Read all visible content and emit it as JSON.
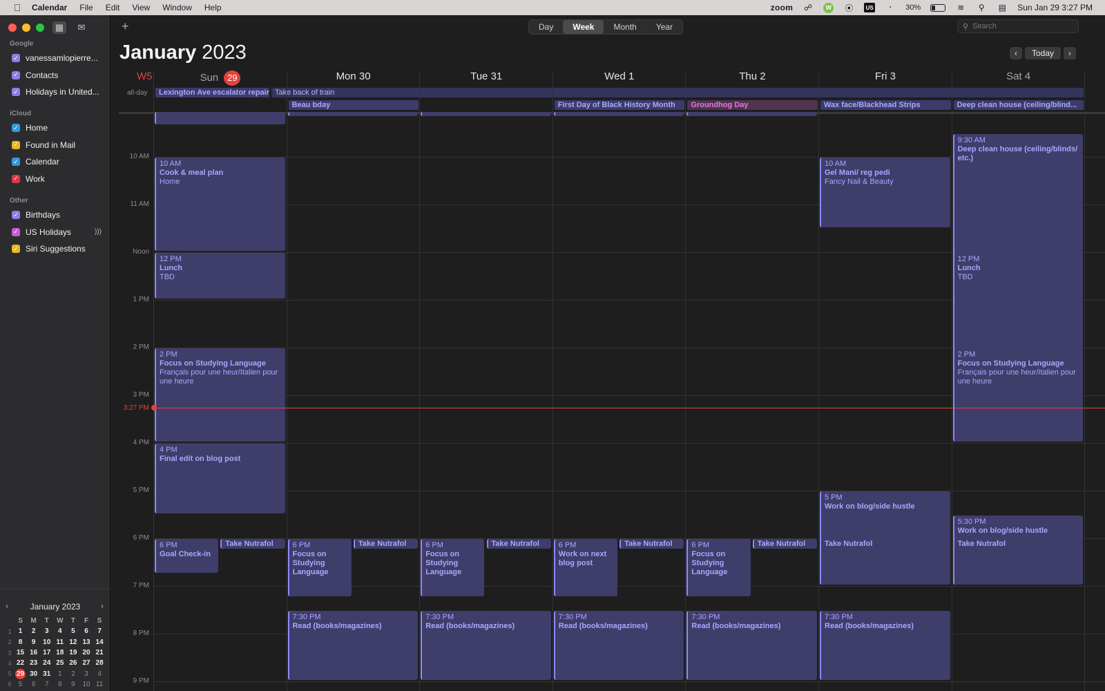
{
  "menubar": {
    "app_name": "Calendar",
    "items": [
      "File",
      "Edit",
      "View",
      "Window",
      "Help"
    ],
    "zoom": "zoom",
    "w_badge": "W",
    "us_badge": "US",
    "battery_pct": "30%",
    "battery_level": 0.3,
    "datetime": "Sun Jan 29  3:27 PM"
  },
  "sidebar": {
    "google_heading": "Google",
    "google": [
      {
        "label": "vanessamlopierre...",
        "color": "#8e7fe6"
      },
      {
        "label": "Contacts",
        "color": "#8e7fe6"
      },
      {
        "label": "Holidays in United...",
        "color": "#8e7fe6"
      }
    ],
    "icloud_heading": "iCloud",
    "icloud": [
      {
        "label": "Home",
        "color": "#2f9ce0"
      },
      {
        "label": "Found in Mail",
        "color": "#e9b823"
      },
      {
        "label": "Calendar",
        "color": "#2f9ce0"
      },
      {
        "label": "Work",
        "color": "#e0344a"
      }
    ],
    "other_heading": "Other",
    "other": [
      {
        "label": "Birthdays",
        "color": "#8e7fe6"
      },
      {
        "label": "US Holidays",
        "color": "#c65cd8"
      },
      {
        "label": "Siri Suggestions",
        "color": "#e9b823"
      }
    ]
  },
  "mini_calendar": {
    "title": "January 2023",
    "headers": [
      "S",
      "M",
      "T",
      "W",
      "T",
      "F",
      "S"
    ],
    "weeks": [
      {
        "wk": "1",
        "days": [
          "1",
          "2",
          "3",
          "4",
          "5",
          "6",
          "7"
        ]
      },
      {
        "wk": "2",
        "days": [
          "8",
          "9",
          "10",
          "11",
          "12",
          "13",
          "14"
        ]
      },
      {
        "wk": "3",
        "days": [
          "15",
          "16",
          "17",
          "18",
          "19",
          "20",
          "21"
        ]
      },
      {
        "wk": "4",
        "days": [
          "22",
          "23",
          "24",
          "25",
          "26",
          "27",
          "28"
        ]
      },
      {
        "wk": "5",
        "days": [
          "29",
          "30",
          "31",
          "1",
          "2",
          "3",
          "4"
        ]
      },
      {
        "wk": "6",
        "days": [
          "5",
          "6",
          "7",
          "8",
          "9",
          "10",
          "11"
        ]
      }
    ],
    "today": "29"
  },
  "toolbar": {
    "add": "+",
    "views": [
      "Day",
      "Week",
      "Month",
      "Year"
    ],
    "active_view": "Week",
    "search_placeholder": "Search",
    "today": "Today"
  },
  "header": {
    "month": "January",
    "year": "2023",
    "week": "W5",
    "days": [
      {
        "name": "Sun",
        "num": "29",
        "today": true
      },
      {
        "name": "Mon",
        "num": "30"
      },
      {
        "name": "Tue",
        "num": "31"
      },
      {
        "name": "Wed",
        "num": "1"
      },
      {
        "name": "Thu",
        "num": "2"
      },
      {
        "name": "Fri",
        "num": "3"
      },
      {
        "name": "Sat",
        "num": "4"
      }
    ]
  },
  "allday_label": "all-day",
  "allday_events": [
    {
      "title": "Lexington Ave escalator repair",
      "day": 0,
      "span": 1,
      "row": 0,
      "style": "blue"
    },
    {
      "title": "Take back of train",
      "day": 0,
      "span": 7,
      "row": 0,
      "style": "plain"
    },
    {
      "title": "Beau bday",
      "day": 1,
      "span": 1,
      "row": 1,
      "style": "blue"
    },
    {
      "title": "First Day of Black History Month",
      "day": 3,
      "span": 1,
      "row": 1,
      "style": "blue"
    },
    {
      "title": "Groundhog Day",
      "day": 4,
      "span": 1,
      "row": 1,
      "style": "pink"
    },
    {
      "title": "Wax face/Blackhead Strips",
      "day": 5,
      "span": 1,
      "row": 1,
      "style": "blue"
    },
    {
      "title": "Deep clean house (ceiling/blind...",
      "day": 6,
      "span": 1,
      "row": 1,
      "style": "blue"
    }
  ],
  "hours": [
    "10 AM",
    "11 AM",
    "Noon",
    "1 PM",
    "2 PM",
    "3 PM",
    "4 PM",
    "5 PM",
    "6 PM",
    "7 PM",
    "8 PM",
    "9 PM"
  ],
  "now_label": "3:27 PM",
  "events": [
    {
      "day": 0,
      "start": 10,
      "end": 12,
      "time": "10 AM",
      "title": "Cook & meal plan",
      "loc": "Home"
    },
    {
      "day": 0,
      "start": 12,
      "end": 13,
      "time": "12 PM",
      "title": "Lunch",
      "loc": "TBD"
    },
    {
      "day": 0,
      "start": 14,
      "end": 16,
      "time": "2 PM",
      "title": "Focus on Studying Language",
      "loc": "Français pour une heur/Italien pour une heure"
    },
    {
      "day": 0,
      "start": 16,
      "end": 17.5,
      "time": "4 PM",
      "title": "Final edit on blog post",
      "loc": ""
    },
    {
      "day": 0,
      "start": 18,
      "end": 18.75,
      "time": "6 PM",
      "title": "Goal Check-in",
      "loc": "",
      "half": "left"
    },
    {
      "day": 0,
      "start": 18,
      "end": 18.25,
      "time": "",
      "title": "Take Nutrafol",
      "loc": "",
      "half": "right"
    },
    {
      "day": 1,
      "start": 18,
      "end": 19.25,
      "time": "6 PM",
      "title": "Focus on Studying Language",
      "loc": "",
      "half": "left"
    },
    {
      "day": 1,
      "start": 18,
      "end": 18.25,
      "time": "",
      "title": "Take Nutrafol",
      "loc": "",
      "half": "right"
    },
    {
      "day": 1,
      "start": 19.5,
      "end": 21,
      "time": "7:30 PM",
      "title": "Read (books/magazines)",
      "loc": ""
    },
    {
      "day": 2,
      "start": 18,
      "end": 19.25,
      "time": "6 PM",
      "title": "Focus on Studying Language",
      "loc": "",
      "half": "left"
    },
    {
      "day": 2,
      "start": 18,
      "end": 18.25,
      "time": "",
      "title": "Take Nutrafol",
      "loc": "",
      "half": "right"
    },
    {
      "day": 2,
      "start": 19.5,
      "end": 21,
      "time": "7:30 PM",
      "title": "Read (books/magazines)",
      "loc": ""
    },
    {
      "day": 3,
      "start": 18,
      "end": 19.25,
      "time": "6 PM",
      "title": "Work on next blog post",
      "loc": "",
      "half": "left"
    },
    {
      "day": 3,
      "start": 18,
      "end": 18.25,
      "time": "",
      "title": "Take Nutrafol",
      "loc": "",
      "half": "right"
    },
    {
      "day": 3,
      "start": 19.5,
      "end": 21,
      "time": "7:30 PM",
      "title": "Read (books/magazines)",
      "loc": ""
    },
    {
      "day": 4,
      "start": 18,
      "end": 19.25,
      "time": "6 PM",
      "title": "Focus on Studying Language",
      "loc": "",
      "half": "left"
    },
    {
      "day": 4,
      "start": 18,
      "end": 18.25,
      "time": "",
      "title": "Take Nutrafol",
      "loc": "",
      "half": "right"
    },
    {
      "day": 4,
      "start": 19.5,
      "end": 21,
      "time": "7:30 PM",
      "title": "Read (books/magazines)",
      "loc": ""
    },
    {
      "day": 5,
      "start": 10,
      "end": 11.5,
      "time": "10 AM",
      "title": "Gel Mani/ reg pedi",
      "loc": "Fancy Nail & Beauty"
    },
    {
      "day": 5,
      "start": 17,
      "end": 19,
      "time": "5 PM",
      "title": "Work on blog/side hustle",
      "loc": ""
    },
    {
      "day": 5,
      "start": 18,
      "end": 19,
      "time": "",
      "title": "Take Nutrafol",
      "loc": ""
    },
    {
      "day": 5,
      "start": 19.5,
      "end": 21,
      "time": "7:30 PM",
      "title": "Read (books/magazines)",
      "loc": ""
    },
    {
      "day": 6,
      "start": 9.5,
      "end": 16,
      "time": "9:30 AM",
      "title": "Deep clean house (ceiling/blinds/ etc.)",
      "loc": ""
    },
    {
      "day": 6,
      "start": 12,
      "end": 13,
      "time": "12 PM",
      "title": "Lunch",
      "loc": "TBD"
    },
    {
      "day": 6,
      "start": 14,
      "end": 16,
      "time": "2 PM",
      "title": "Focus on Studying Language",
      "loc": "Français pour une heur/Italien pour une heure"
    },
    {
      "day": 6,
      "start": 17.5,
      "end": 19,
      "time": "5:30 PM",
      "title": "Work on blog/side hustle",
      "loc": ""
    },
    {
      "day": 6,
      "start": 18,
      "end": 19,
      "time": "",
      "title": "Take Nutrafol",
      "loc": ""
    }
  ]
}
